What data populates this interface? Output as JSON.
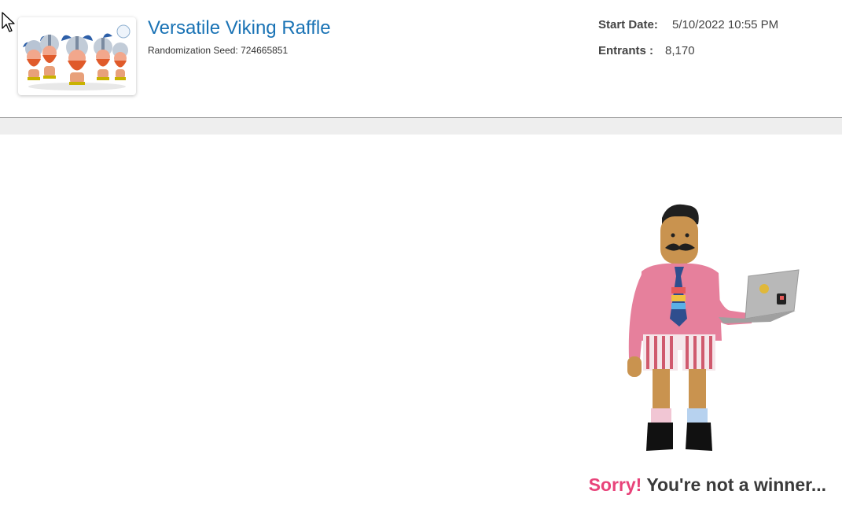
{
  "raffle": {
    "title": "Versatile Viking Raffle",
    "seed_label": "Randomization Seed: 724665851"
  },
  "meta": {
    "start_label": "Start Date:",
    "start_value": "5/10/2022 10:55 PM",
    "entrants_label": "Entrants :",
    "entrants_value": "8,170"
  },
  "result": {
    "sorry": "Sorry!",
    "message": "You're not a winner..."
  },
  "colors": {
    "title": "#1a73b5",
    "sorry": "#e8437a",
    "band": "#eeeeee"
  },
  "icons": [
    "viking-raffle-thumbnail",
    "mouse-cursor-icon",
    "man-with-laptop-illustration"
  ]
}
